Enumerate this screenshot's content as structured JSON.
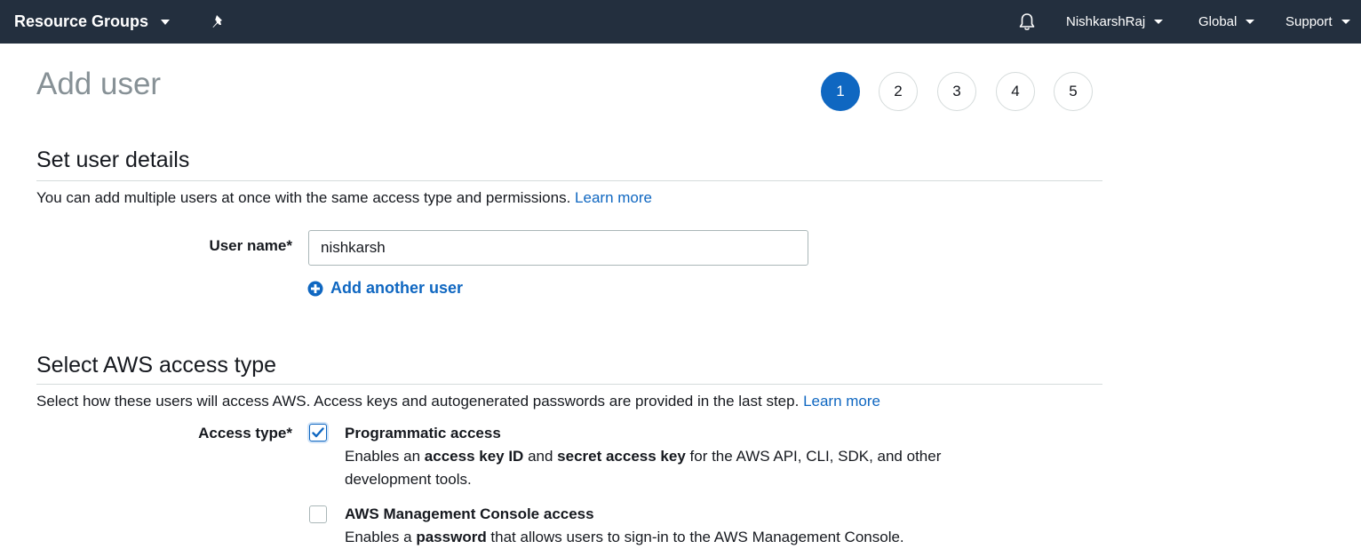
{
  "nav": {
    "resource_groups": "Resource Groups",
    "user": "NishkarshRaj",
    "region": "Global",
    "support": "Support",
    "icons": [
      "chevron-down-icon",
      "pin-icon",
      "bell-icon"
    ]
  },
  "page": {
    "title": "Add user",
    "steps": [
      "1",
      "2",
      "3",
      "4",
      "5"
    ],
    "active_step": "1"
  },
  "user_details": {
    "heading": "Set user details",
    "description": "You can add multiple users at once with the same access type and permissions.",
    "learn_more": "Learn more",
    "user_name_label": "User name*",
    "user_name_value": "nishkarsh",
    "add_another": "Add another user"
  },
  "access_type": {
    "heading": "Select AWS access type",
    "description": "Select how these users will access AWS. Access keys and autogenerated passwords are provided in the last step.",
    "learn_more": "Learn more",
    "label": "Access type*",
    "programmatic": {
      "title": "Programmatic access",
      "desc_1": "Enables an ",
      "desc_b1": "access key ID",
      "desc_2": " and ",
      "desc_b2": "secret access key",
      "desc_3": " for the AWS API, CLI, SDK, and other development tools.",
      "checked": true
    },
    "console": {
      "title": "AWS Management Console access",
      "desc_1": "Enables a ",
      "desc_b1": "password",
      "desc_2": " that allows users to sign-in to the AWS Management Console.",
      "checked": false
    }
  },
  "colors": {
    "nav_bg": "#232f3e",
    "accent": "#0f67c1"
  }
}
